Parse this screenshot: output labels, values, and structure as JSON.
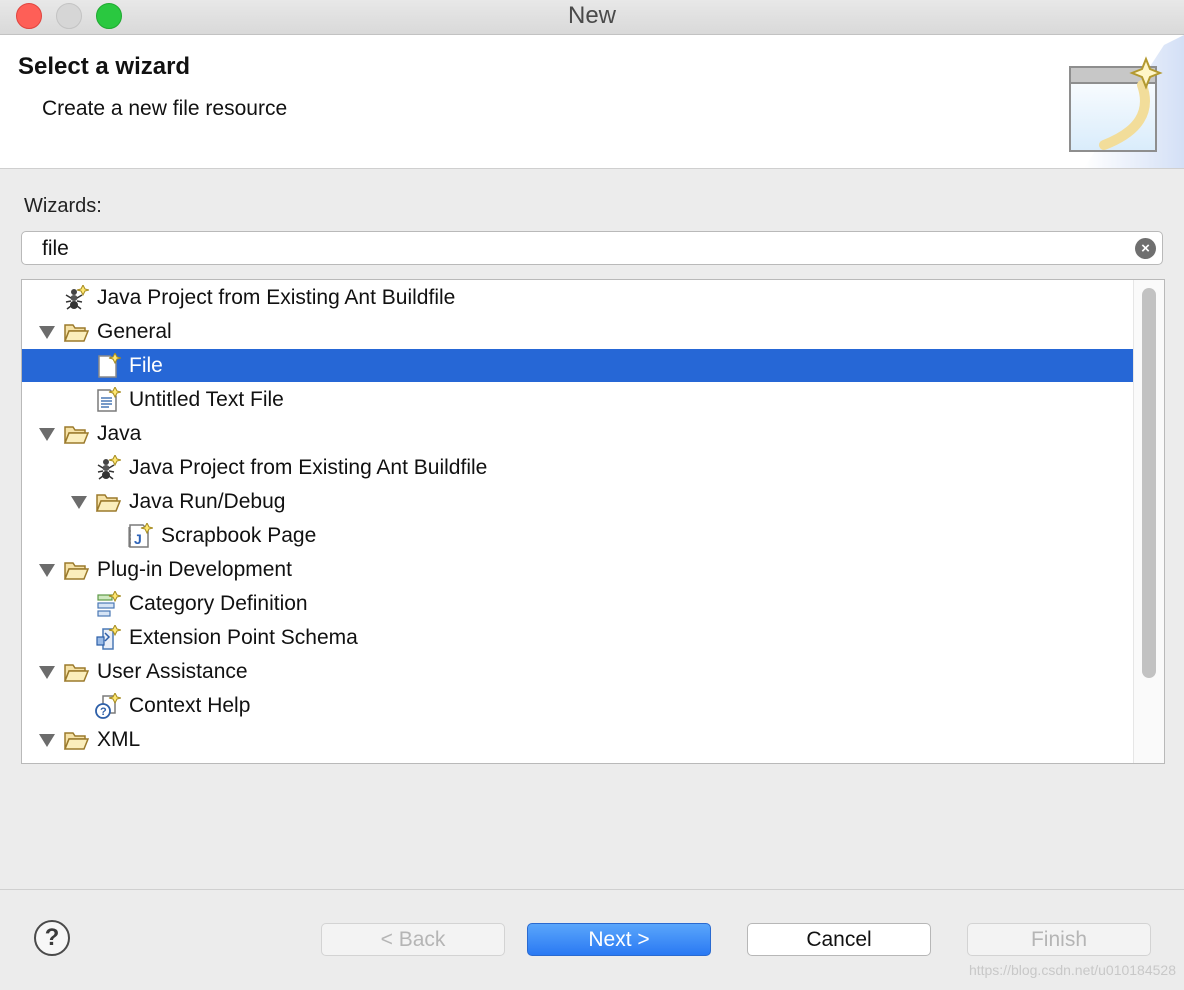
{
  "window": {
    "title": "New"
  },
  "header": {
    "title": "Select a wizard",
    "subtitle": "Create a new file resource",
    "art_icon": "new-wizard-banner-icon"
  },
  "filter": {
    "label": "Wizards:",
    "value": "file",
    "clear_icon": "clear-search-icon"
  },
  "tree": {
    "items": [
      {
        "label": "Java Project from Existing Ant Buildfile",
        "icon": "ant-buildfile-icon",
        "depth": 0,
        "expandable": false,
        "selected": false
      },
      {
        "label": "General",
        "icon": "folder-open-icon",
        "depth": 0,
        "expandable": true,
        "selected": false
      },
      {
        "label": "File",
        "icon": "new-file-icon",
        "depth": 1,
        "expandable": false,
        "selected": true
      },
      {
        "label": "Untitled Text File",
        "icon": "text-file-icon",
        "depth": 1,
        "expandable": false,
        "selected": false
      },
      {
        "label": "Java",
        "icon": "folder-open-icon",
        "depth": 0,
        "expandable": true,
        "selected": false
      },
      {
        "label": "Java Project from Existing Ant Buildfile",
        "icon": "ant-buildfile-icon",
        "depth": 1,
        "expandable": false,
        "selected": false
      },
      {
        "label": "Java Run/Debug",
        "icon": "folder-open-icon",
        "depth": 1,
        "expandable": true,
        "selected": false
      },
      {
        "label": "Scrapbook Page",
        "icon": "scrapbook-page-icon",
        "depth": 2,
        "expandable": false,
        "selected": false
      },
      {
        "label": "Plug-in Development",
        "icon": "folder-open-icon",
        "depth": 0,
        "expandable": true,
        "selected": false
      },
      {
        "label": "Category Definition",
        "icon": "category-definition-icon",
        "depth": 1,
        "expandable": false,
        "selected": false
      },
      {
        "label": "Extension Point Schema",
        "icon": "extension-point-schema-icon",
        "depth": 1,
        "expandable": false,
        "selected": false
      },
      {
        "label": "User Assistance",
        "icon": "folder-open-icon",
        "depth": 0,
        "expandable": true,
        "selected": false
      },
      {
        "label": "Context Help",
        "icon": "context-help-icon",
        "depth": 1,
        "expandable": false,
        "selected": false
      },
      {
        "label": "XML",
        "icon": "folder-open-icon",
        "depth": 0,
        "expandable": true,
        "selected": false
      }
    ]
  },
  "buttons": {
    "help_icon": "help-icon",
    "back": "< Back",
    "next": "Next >",
    "cancel": "Cancel",
    "finish": "Finish"
  },
  "watermark": "https://blog.csdn.net/u010184528",
  "colors": {
    "selection": "#2667d6",
    "primary_button": "#2a79f3",
    "close": "#fe5f57",
    "maximize": "#2ac840"
  }
}
